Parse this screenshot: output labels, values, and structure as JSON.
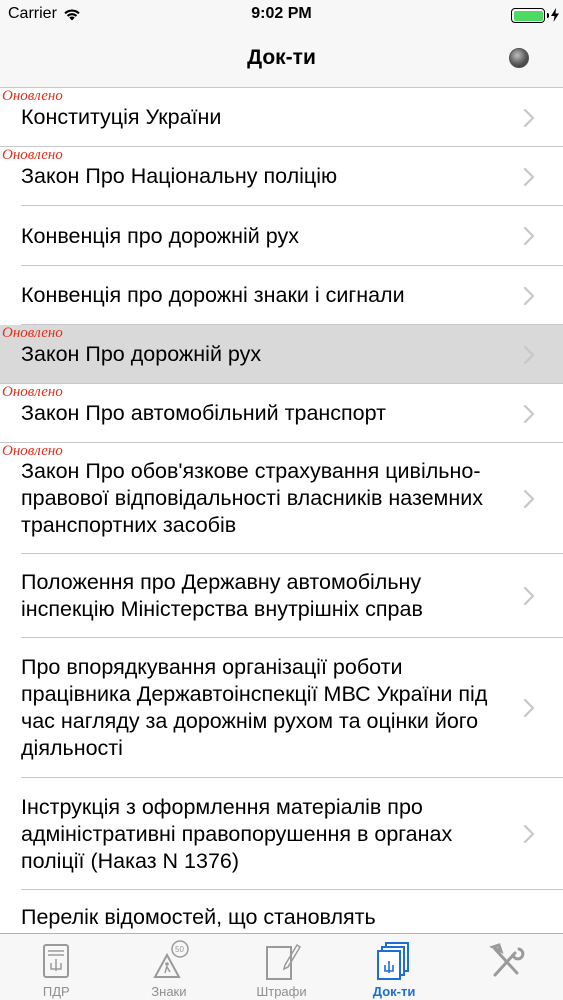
{
  "status_bar": {
    "carrier": "Carrier",
    "time": "9:02 PM",
    "wifi_icon": "wifi-icon",
    "battery_icon": "battery-icon",
    "battery_percent": 100,
    "battery_color": "#4cd964"
  },
  "nav": {
    "title": "Док-ти",
    "status_indicator_icon": "status-dot-icon"
  },
  "updated_badge_text": "Оновлено",
  "documents": [
    {
      "title": "Конституція України",
      "updated": true,
      "selected": false
    },
    {
      "title": "Закон Про Національну поліцію",
      "updated": true,
      "selected": false
    },
    {
      "title": "Конвенція про дорожній рух",
      "updated": false,
      "selected": false
    },
    {
      "title": "Конвенція про дорожні знаки і сигнали",
      "updated": false,
      "selected": false
    },
    {
      "title": "Закон Про дорожній рух",
      "updated": true,
      "selected": true
    },
    {
      "title": "Закон Про автомобільний транспорт",
      "updated": true,
      "selected": false
    },
    {
      "title": "Закон Про обов'язкове страхування цивільно-правової відповідальності власників наземних транспортних засобів",
      "updated": true,
      "selected": false
    },
    {
      "title": "Положення про Державну автомобільну інспекцію Міністерства внутрішніх справ",
      "updated": false,
      "selected": false
    },
    {
      "title": "Про впорядкування організації роботи працівника Державтоінспекції МВС України під час нагляду за дорожнім рухом та оцінки його діяльності",
      "updated": false,
      "selected": false
    },
    {
      "title": "Інструкція з оформлення матеріалів про адміністративні правопорушення в органах поліції (Наказ N 1376)",
      "updated": false,
      "selected": false
    },
    {
      "title": "Перелік відомостей, що становлять",
      "updated": false,
      "selected": false
    }
  ],
  "tabs": [
    {
      "label": "ПДР",
      "icon": "pdr-book-icon",
      "active": false
    },
    {
      "label": "Знаки",
      "icon": "road-sign-icon",
      "active": false
    },
    {
      "label": "Штрафи",
      "icon": "fines-document-icon",
      "active": false
    },
    {
      "label": "Док-ти",
      "icon": "documents-icon",
      "active": true
    },
    {
      "label": "",
      "icon": "tools-settings-icon",
      "active": false
    }
  ],
  "colors": {
    "accent": "#1c6fd6",
    "updated_badge": "#e0321e",
    "selected_row": "#d9d9d9",
    "inactive_tab": "#8e8e93"
  }
}
